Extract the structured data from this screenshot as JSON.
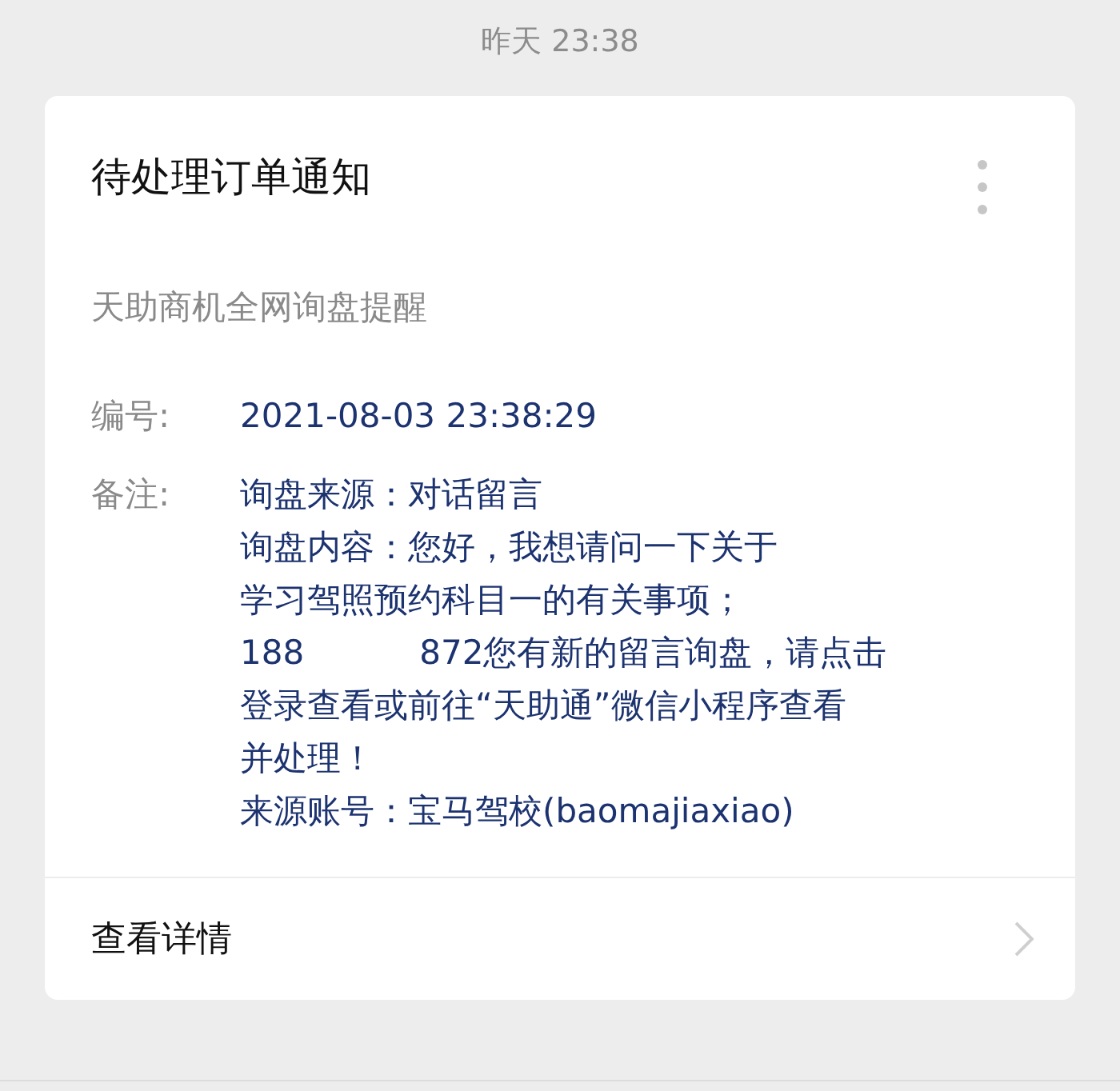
{
  "timestamp": "昨天 23:38",
  "card": {
    "title": "待处理订单通知",
    "subtitle": "天助商机全网询盘提醒",
    "fields": [
      {
        "label": "编号:",
        "lines": [
          [
            "2021-08-03 23:38:29"
          ]
        ]
      },
      {
        "label": "备注:",
        "lines": [
          [
            "询盘来源：对话留言"
          ],
          [
            "询盘内容：您好，我想请问一下关于"
          ],
          [
            "学习驾照预约科目一的有关事项；"
          ],
          [
            "188",
            "872您有新的留言询盘，请点击"
          ],
          [
            "登录查看或前往“天助通”微信小程序查看"
          ],
          [
            "并处理！"
          ],
          [
            "来源账号：宝马驾校(baomajiaxiao)"
          ]
        ]
      }
    ],
    "footer": {
      "label": "查看详情"
    }
  }
}
